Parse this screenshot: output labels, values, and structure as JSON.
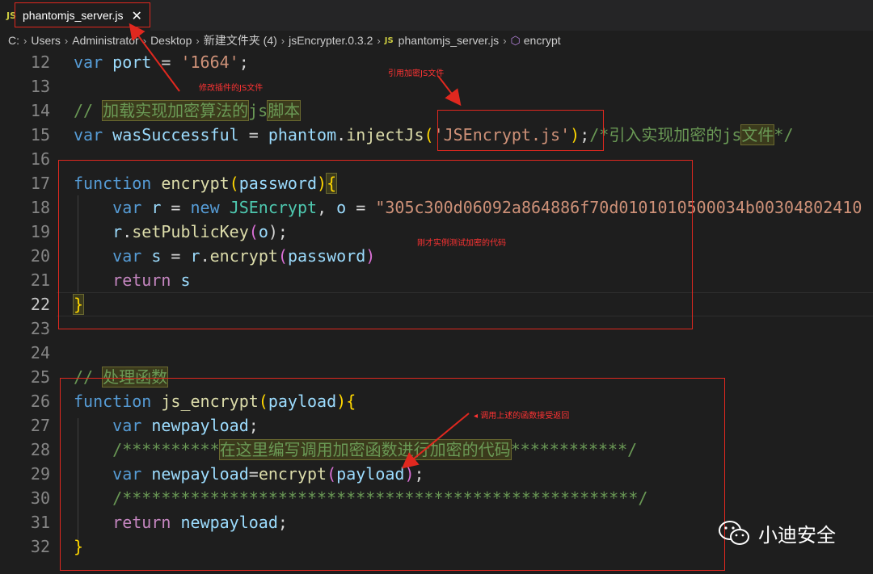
{
  "tab": {
    "badge": "JS",
    "title": "phantomjs_server.js",
    "close": "✕"
  },
  "breadcrumb": {
    "items": [
      "C:",
      "Users",
      "Administrator",
      "Desktop",
      "新建文件夹 (4)",
      "jsEncrypter.0.3.2",
      "phantomjs_server.js",
      "encrypt"
    ],
    "file_badge": "JS"
  },
  "lines": [
    {
      "n": "12"
    },
    {
      "n": "13"
    },
    {
      "n": "14"
    },
    {
      "n": "15"
    },
    {
      "n": "16"
    },
    {
      "n": "17"
    },
    {
      "n": "18"
    },
    {
      "n": "19"
    },
    {
      "n": "20"
    },
    {
      "n": "21"
    },
    {
      "n": "22"
    },
    {
      "n": "23"
    },
    {
      "n": "24"
    },
    {
      "n": "25"
    },
    {
      "n": "26"
    },
    {
      "n": "27"
    },
    {
      "n": "28"
    },
    {
      "n": "29"
    },
    {
      "n": "30"
    },
    {
      "n": "31"
    },
    {
      "n": "32"
    }
  ],
  "code": {
    "l12": {
      "kw": "var",
      "name": "port",
      "op": " = ",
      "val": "'1664'",
      "end": ";"
    },
    "l14": {
      "slash": "// ",
      "text": "加载实现加密算法的",
      "js": "js",
      "text2": "脚本"
    },
    "l15": {
      "kw": "var",
      "name": "wasSuccessful",
      "op": " = ",
      "obj": "phantom",
      "dot": ".",
      "fn": "injectJs",
      "arg": "'JSEncrypt.js'",
      "end": ";",
      "cm1": "/*引入实现加密的",
      "cm_js": "js",
      "cm2": "文件",
      "cm3": "*/"
    },
    "l17": {
      "kw": "function",
      "fn": "encrypt",
      "param": "password"
    },
    "l18": {
      "kw": "var",
      "r": "r",
      "op": " = ",
      "new": "new",
      "cls": "JSEncrypt",
      "comma": ", ",
      "o": "o",
      "op2": " = ",
      "str": "\"305c300d06092a864886f70d0101010500034b00304802410"
    },
    "l19": {
      "obj": "r",
      "fn": "setPublicKey",
      "arg": "o",
      "end": ");"
    },
    "l20": {
      "kw": "var",
      "s": "s",
      "op": " = ",
      "obj": "r",
      "fn": "encrypt",
      "arg": "password"
    },
    "l21": {
      "kw": "return",
      "s": "s"
    },
    "l25": {
      "slash": "// ",
      "text": "处理函数"
    },
    "l26": {
      "kw": "function",
      "fn": "js_encrypt",
      "param": "payload"
    },
    "l27": {
      "kw": "var",
      "name": "newpayload",
      "end": ";"
    },
    "l28": {
      "stars1": "/**********",
      "text": "在这里编写调用加密函数进行加密的代码",
      "stars2": "************/"
    },
    "l29": {
      "kw": "var",
      "name": "newpayload",
      "eq": "=",
      "fn": "encrypt",
      "arg": "payload",
      "end": ";"
    },
    "l30": {
      "stars": "/*****************************************************/"
    },
    "l31": {
      "kw": "return",
      "name": "newpayload",
      "end": ";"
    }
  },
  "annotations": {
    "modify_plugin": "修改插件的JS文件",
    "import_js": "引用加密JS文件",
    "test_code": "刚才实例测试加密的代码",
    "call_func": "◂  调用上述的函数接受返回"
  },
  "watermark": {
    "text": "小迪安全"
  },
  "colors": {
    "background": "#1e1e1e",
    "keyword": "#569cd6",
    "string": "#ce9178",
    "comment": "#6a9955",
    "function": "#dcdcaa",
    "variable": "#9cdcfe",
    "annotation": "#e0281f"
  }
}
